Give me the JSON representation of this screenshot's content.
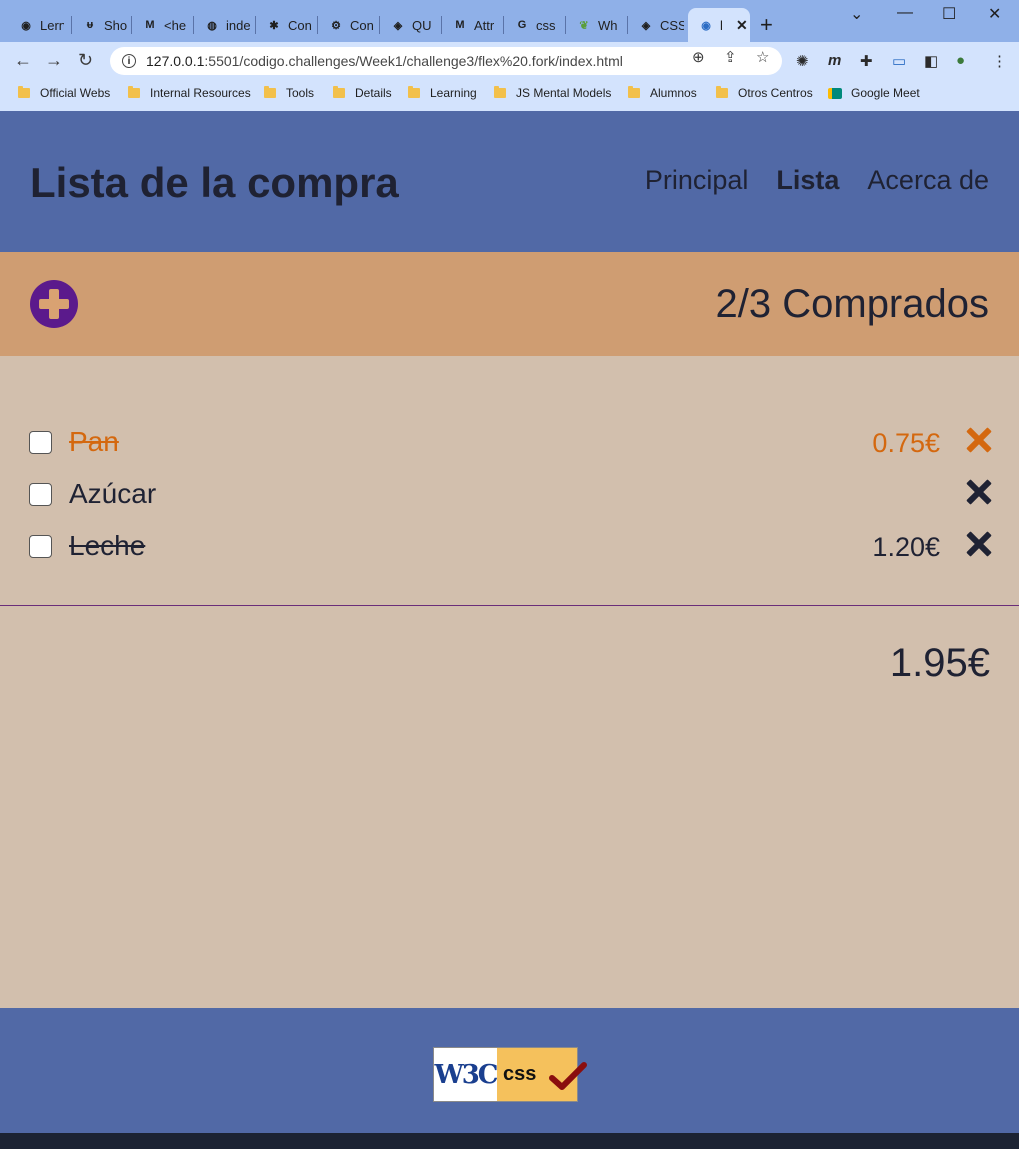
{
  "browser": {
    "tabs": [
      {
        "label": "Lern",
        "icon": "globe-icon"
      },
      {
        "label": "Sho",
        "icon": "app-icon"
      },
      {
        "label": "<he",
        "icon": "mdn-icon"
      },
      {
        "label": "inde",
        "icon": "github-icon"
      },
      {
        "label": "Con",
        "icon": "paw-icon"
      },
      {
        "label": "Con",
        "icon": "gear-icon"
      },
      {
        "label": "QU",
        "icon": "codepen-icon"
      },
      {
        "label": "Attr",
        "icon": "mdn-icon"
      },
      {
        "label": "css",
        "icon": "google-icon"
      },
      {
        "label": "Wh",
        "icon": "leaf-icon"
      },
      {
        "label": "CSS",
        "icon": "codepen-icon"
      },
      {
        "label": "l",
        "icon": "globe-icon",
        "active": true
      }
    ],
    "url_host": "127.0.0.1",
    "url_path": ":5501/codigo.challenges/Week1/challenge3/flex%20.fork/index.html",
    "bookmarks": [
      "Official Webs",
      "Internal Resources",
      "Tools",
      "Details",
      "Learning",
      "JS Mental Models",
      "Alumnos",
      "Otros Centros",
      "Google Meet"
    ]
  },
  "header": {
    "title": "Lista de la compra",
    "nav": [
      "Principal",
      "Lista",
      "Acerca de"
    ],
    "nav_current": "Lista"
  },
  "summary": {
    "count_text": "2/3 Comprados"
  },
  "items": [
    {
      "name": "Pan",
      "price": "0.75€",
      "checked": false,
      "struck": true
    },
    {
      "name": "Azúcar",
      "price": "",
      "checked": false,
      "struck": false
    },
    {
      "name": "Leche",
      "price": "1.20€",
      "checked": false,
      "struck": true
    }
  ],
  "total": "1.95€",
  "footer": {
    "badge_left": "W3C",
    "badge_right": "css"
  },
  "colors": {
    "header_bg": "#5169a6",
    "summary_bg": "#cf9d72",
    "page_bg": "#d2bfad",
    "accent_purple": "#5b1a8c",
    "highlight_orange": "#d4680f"
  }
}
